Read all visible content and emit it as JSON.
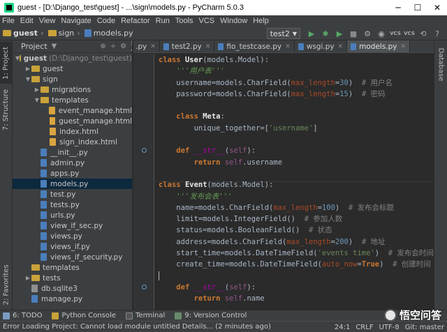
{
  "window": {
    "title": "guest - [D:\\Django_test\\guest] - ...\\sign\\models.py - PyCharm 5.0.3",
    "minimize": "─",
    "maximize": "☐",
    "close": "✕"
  },
  "menu": [
    "File",
    "Edit",
    "View",
    "Navigate",
    "Code",
    "Refactor",
    "Run",
    "Tools",
    "VCS",
    "Window",
    "Help"
  ],
  "breadcrumb": {
    "project": "guest",
    "folder": "sign",
    "file": "models.py"
  },
  "toolbar": {
    "run_config": "test2",
    "vcs1": "VCS",
    "vcs2": "VCS"
  },
  "left_strip": {
    "project": "1: Project",
    "structure": "7: Structure",
    "favorites": "2: Favorites"
  },
  "right_strip": {
    "database": "Database"
  },
  "project_panel": {
    "title": "Project",
    "items": [
      {
        "label": "guest",
        "extra": "(D:\\Django_test\\guest)",
        "indent": 0,
        "type": "folder",
        "expanded": true
      },
      {
        "label": "guest",
        "indent": 1,
        "type": "folder",
        "expanded": false
      },
      {
        "label": "sign",
        "indent": 1,
        "type": "folder",
        "expanded": true
      },
      {
        "label": "migrations",
        "indent": 2,
        "type": "folder",
        "expanded": false
      },
      {
        "label": "templates",
        "indent": 2,
        "type": "folder",
        "expanded": true
      },
      {
        "label": "event_manage.html",
        "indent": 3,
        "type": "html"
      },
      {
        "label": "guest_manage.html",
        "indent": 3,
        "type": "html"
      },
      {
        "label": "index.html",
        "indent": 3,
        "type": "html"
      },
      {
        "label": "sign_index.html",
        "indent": 3,
        "type": "html"
      },
      {
        "label": "__init__.py",
        "indent": 2,
        "type": "py"
      },
      {
        "label": "admin.py",
        "indent": 2,
        "type": "py"
      },
      {
        "label": "apps.py",
        "indent": 2,
        "type": "py"
      },
      {
        "label": "models.py",
        "indent": 2,
        "type": "py",
        "selected": true
      },
      {
        "label": "test.py",
        "indent": 2,
        "type": "py"
      },
      {
        "label": "tests.py",
        "indent": 2,
        "type": "py"
      },
      {
        "label": "urls.py",
        "indent": 2,
        "type": "py"
      },
      {
        "label": "view_if_sec.py",
        "indent": 2,
        "type": "py"
      },
      {
        "label": "views.py",
        "indent": 2,
        "type": "py"
      },
      {
        "label": "views_if.py",
        "indent": 2,
        "type": "py"
      },
      {
        "label": "views_if_security.py",
        "indent": 2,
        "type": "py"
      },
      {
        "label": "templates",
        "indent": 1,
        "type": "folder-plain"
      },
      {
        "label": "tests",
        "indent": 1,
        "type": "folder",
        "expanded": false
      },
      {
        "label": "db.sqlite3",
        "indent": 1,
        "type": "db"
      },
      {
        "label": "manage.py",
        "indent": 1,
        "type": "py"
      }
    ]
  },
  "tabs": [
    {
      "label": ".py",
      "partial": true
    },
    {
      "label": "test2.py"
    },
    {
      "label": "fio_testcase.py"
    },
    {
      "label": "wsgi.py"
    },
    {
      "label": "models.py",
      "active": true
    }
  ],
  "code": {
    "l1_kw": "class ",
    "l1_name": "User",
    "l1_rest": "(models.Model):",
    "l2": "'''用户表'''",
    "l3_a": "username=models.CharField(",
    "l3_p": "max_length",
    "l3_b": "=",
    "l3_n": "30",
    "l3_c": ")",
    "l3_cm": "  # 用户名",
    "l4_a": "password=models.CharField(",
    "l4_p": "max_length",
    "l4_b": "=",
    "l4_n": "15",
    "l4_c": ")",
    "l4_cm": "  # 密码",
    "l6_kw": "class ",
    "l6_name": "Meta",
    "l6_rest": ":",
    "l7_a": "unique_together=[",
    "l7_s": "'username'",
    "l7_b": "]",
    "l9_kw": "def ",
    "l9_fn": "__str__",
    "l9_a": "(",
    "l9_self": "self",
    "l9_b": "):",
    "l10_kw": "return ",
    "l10_self": "self",
    "l10_b": ".username",
    "l12_kw": "class ",
    "l12_name": "Event",
    "l12_rest": "(models.Model):",
    "l13": "'''发布会表'''",
    "l14_a": "name=models.CharField(",
    "l14_p": "max_length",
    "l14_b": "=",
    "l14_n": "100",
    "l14_c": ")",
    "l14_cm": "  # 发布会标题",
    "l15_a": "limit=models.IntegerField()",
    "l15_cm": "  # 参加人数",
    "l16_a": "status=models.BooleanField()",
    "l16_cm": "  # 状态",
    "l17_a": "address=models.CharField(",
    "l17_p": "max_length",
    "l17_b": "=",
    "l17_n": "200",
    "l17_c": ")",
    "l17_cm": "  # 地址",
    "l18_a": "start_time=models.DateTimeField(",
    "l18_s": "'events time'",
    "l18_c": ")",
    "l18_cm": "  # 发布会时间",
    "l19_a": "create_time=models.DateTimeField(",
    "l19_p": "auto_now",
    "l19_b": "=",
    "l19_kw": "True",
    "l19_c": ")",
    "l19_cm": "  # 创建时间（自动获",
    "l21_kw": "def ",
    "l21_fn": "__str__",
    "l21_a": "(",
    "l21_self": "self",
    "l21_b": "):",
    "l22_kw": "return ",
    "l22_self": "self",
    "l22_b": ".name"
  },
  "bottom_tools": [
    {
      "label": "6: TODO",
      "color": "#7a9bc1"
    },
    {
      "label": "Python Console",
      "color": "#c9a23a"
    },
    {
      "label": "Terminal",
      "color": "#555555"
    },
    {
      "label": "9: Version Control",
      "color": "#6a8b6b"
    }
  ],
  "status": {
    "message": "Error Loading Project: Cannot load module untitled Details... (2 minutes ago)",
    "position": "24:1",
    "line_sep": "CRLF",
    "encoding": "UTF-8",
    "git": "Git: master"
  },
  "watermark": "悟空问答"
}
